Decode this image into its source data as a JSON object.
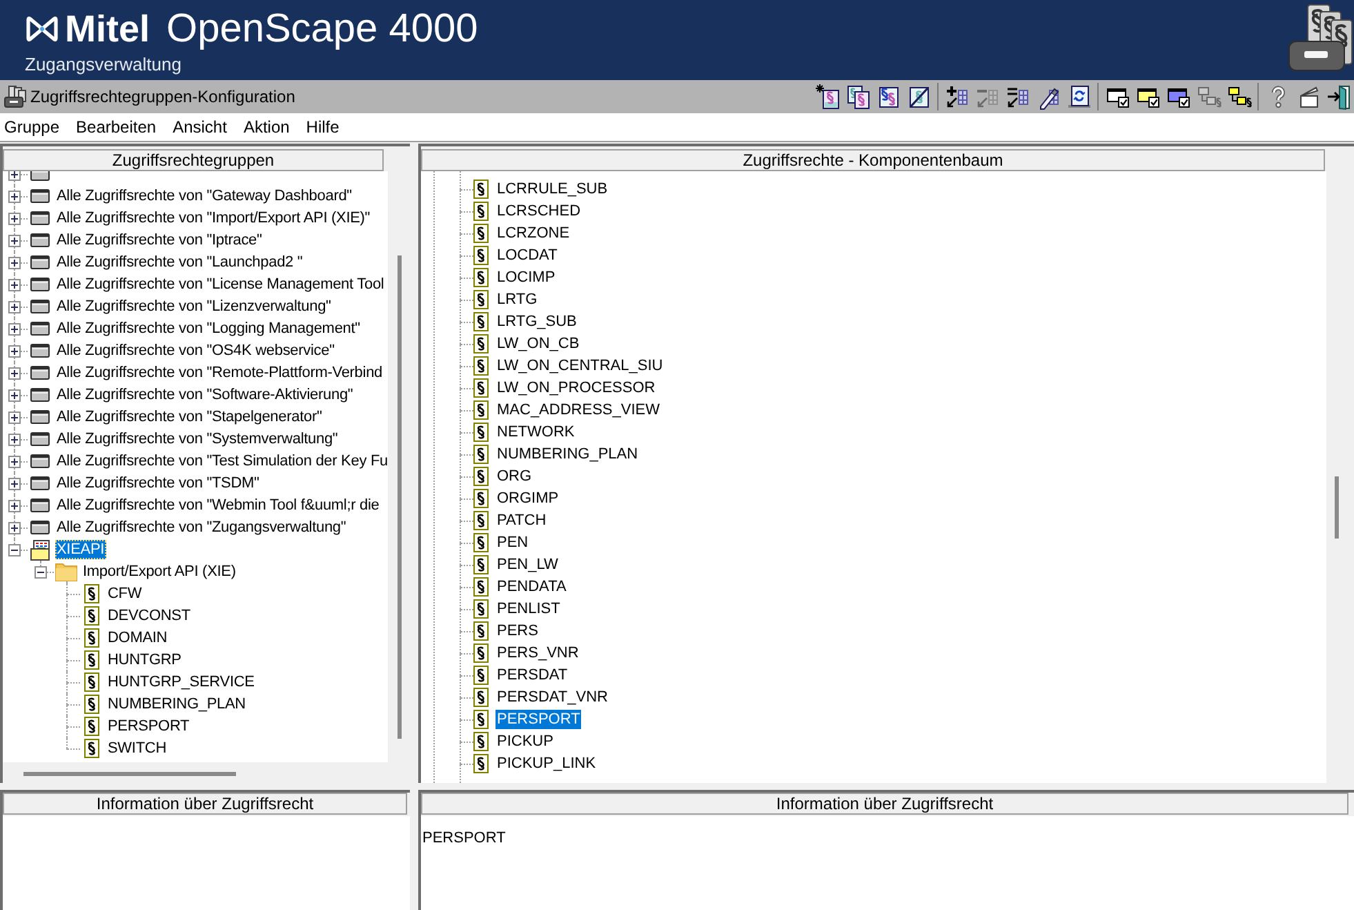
{
  "header": {
    "brand": "Mitel",
    "product": "OpenScape 4000",
    "subtitle": "Zugangsverwaltung"
  },
  "window": {
    "title": "Zugriffsrechtegruppen-Konfiguration"
  },
  "toolbar": [
    {
      "kind": "new",
      "disabled": false
    },
    {
      "kind": "copy",
      "disabled": false
    },
    {
      "kind": "sections",
      "disabled": false
    },
    {
      "kind": "slash",
      "disabled": false
    },
    {
      "kind": "separator"
    },
    {
      "kind": "add",
      "disabled": false
    },
    {
      "kind": "remove",
      "disabled": true
    },
    {
      "kind": "replace",
      "disabled": false
    },
    {
      "kind": "edit",
      "disabled": false
    },
    {
      "kind": "refresh",
      "disabled": false
    },
    {
      "kind": "separator"
    },
    {
      "kind": "checkframe",
      "color": "#ffffff",
      "disabled": false
    },
    {
      "kind": "checkframe",
      "color": "#ffff80",
      "disabled": false
    },
    {
      "kind": "checkframe",
      "color": "#8080ff",
      "disabled": false
    },
    {
      "kind": "tree",
      "disabled": true
    },
    {
      "kind": "tree",
      "disabled": false
    },
    {
      "kind": "separator"
    },
    {
      "kind": "help",
      "disabled": false
    },
    {
      "kind": "lid",
      "disabled": false
    },
    {
      "kind": "exit",
      "disabled": false
    }
  ],
  "menu": [
    "Gruppe",
    "Bearbeiten",
    "Ansicht",
    "Aktion",
    "Hilfe"
  ],
  "left_panel": {
    "header": "Zugriffsrechtegruppen",
    "tree": [
      {
        "kind": "builtin",
        "expanded": false
      },
      {
        "label": "Alle Zugriffsrechte von \"Gateway Dashboard\"",
        "kind": "builtin",
        "expanded": false,
        "selected": false
      },
      {
        "label": "Alle Zugriffsrechte von \"Import/Export API (XIE)\"",
        "kind": "builtin",
        "expanded": false,
        "selected": false
      },
      {
        "label": "Alle Zugriffsrechte von \"Iptrace\"",
        "kind": "builtin",
        "expanded": false,
        "selected": false
      },
      {
        "label": "Alle Zugriffsrechte von \"Launchpad2 \"",
        "kind": "builtin",
        "expanded": false,
        "selected": false
      },
      {
        "label": "Alle Zugriffsrechte von \"License Management Tool",
        "kind": "builtin",
        "expanded": false,
        "selected": false
      },
      {
        "label": "Alle Zugriffsrechte von \"Lizenzverwaltung\"",
        "kind": "builtin",
        "expanded": false,
        "selected": false
      },
      {
        "label": "Alle Zugriffsrechte von \"Logging Management\"",
        "kind": "builtin",
        "expanded": false,
        "selected": false
      },
      {
        "label": "Alle Zugriffsrechte von \"OS4K webservice\"",
        "kind": "builtin",
        "expanded": false,
        "selected": false
      },
      {
        "label": "Alle Zugriffsrechte von \"Remote-Plattform-Verbind",
        "kind": "builtin",
        "expanded": false,
        "selected": false
      },
      {
        "label": "Alle Zugriffsrechte von \"Software-Aktivierung\"",
        "kind": "builtin",
        "expanded": false,
        "selected": false
      },
      {
        "label": "Alle Zugriffsrechte von \"Stapelgenerator\"",
        "kind": "builtin",
        "expanded": false,
        "selected": false
      },
      {
        "label": "Alle Zugriffsrechte von \"Systemverwaltung\"",
        "kind": "builtin",
        "expanded": false,
        "selected": false
      },
      {
        "label": "Alle Zugriffsrechte von \"Test Simulation der Key Fu",
        "kind": "builtin",
        "expanded": false,
        "selected": false
      },
      {
        "label": "Alle Zugriffsrechte von \"TSDM\"",
        "kind": "builtin",
        "expanded": false,
        "selected": false
      },
      {
        "label": "Alle Zugriffsrechte von \"Webmin Tool f&uuml;r die",
        "kind": "builtin",
        "expanded": false,
        "selected": false
      },
      {
        "label": "Alle Zugriffsrechte von \"Zugangsverwaltung\"",
        "kind": "builtin",
        "expanded": false,
        "selected": false
      },
      {
        "label": "XIEAPI",
        "kind": "custom",
        "expanded": true,
        "selected": true,
        "children": [
          {
            "label": "Import/Export API (XIE)",
            "kind": "folder",
            "expanded": true,
            "selected": false,
            "children": [
              {
                "label": "CFW",
                "kind": "right",
                "selected": false
              },
              {
                "label": "DEVCONST",
                "kind": "right",
                "selected": false
              },
              {
                "label": "DOMAIN",
                "kind": "right",
                "selected": false
              },
              {
                "label": "HUNTGRP",
                "kind": "right",
                "selected": false
              },
              {
                "label": "HUNTGRP_SERVICE",
                "kind": "right",
                "selected": false
              },
              {
                "label": "NUMBERING_PLAN",
                "kind": "right",
                "selected": false
              },
              {
                "label": "PERSPORT",
                "kind": "right",
                "selected": false
              },
              {
                "label": "SWITCH",
                "kind": "right",
                "selected": false
              }
            ]
          }
        ]
      }
    ]
  },
  "right_panel": {
    "header": "Zugriffsrechte - Komponentenbaum",
    "tree": [
      {
        "label": "LCRRULE_SUB",
        "selected": false
      },
      {
        "label": "LCRSCHED",
        "selected": false
      },
      {
        "label": "LCRZONE",
        "selected": false
      },
      {
        "label": "LOCDAT",
        "selected": false
      },
      {
        "label": "LOCIMP",
        "selected": false
      },
      {
        "label": "LRTG",
        "selected": false
      },
      {
        "label": "LRTG_SUB",
        "selected": false
      },
      {
        "label": "LW_ON_CB",
        "selected": false
      },
      {
        "label": "LW_ON_CENTRAL_SIU",
        "selected": false
      },
      {
        "label": "LW_ON_PROCESSOR",
        "selected": false
      },
      {
        "label": "MAC_ADDRESS_VIEW",
        "selected": false
      },
      {
        "label": "NETWORK",
        "selected": false
      },
      {
        "label": "NUMBERING_PLAN",
        "selected": false
      },
      {
        "label": "ORG",
        "selected": false
      },
      {
        "label": "ORGIMP",
        "selected": false
      },
      {
        "label": "PATCH",
        "selected": false
      },
      {
        "label": "PEN",
        "selected": false
      },
      {
        "label": "PEN_LW",
        "selected": false
      },
      {
        "label": "PENDATA",
        "selected": false
      },
      {
        "label": "PENLIST",
        "selected": false
      },
      {
        "label": "PERS",
        "selected": false
      },
      {
        "label": "PERS_VNR",
        "selected": false
      },
      {
        "label": "PERSDAT",
        "selected": false
      },
      {
        "label": "PERSDAT_VNR",
        "selected": false
      },
      {
        "label": "PERSPORT",
        "selected": true
      },
      {
        "label": "PICKUP",
        "selected": false
      },
      {
        "label": "PICKUP_LINK",
        "selected": false
      }
    ]
  },
  "info_panels": [
    {
      "header": "Information über Zugriffsrecht"
    },
    {
      "header": "Information über Zugriffsrecht",
      "text": "PERSPORT"
    }
  ]
}
